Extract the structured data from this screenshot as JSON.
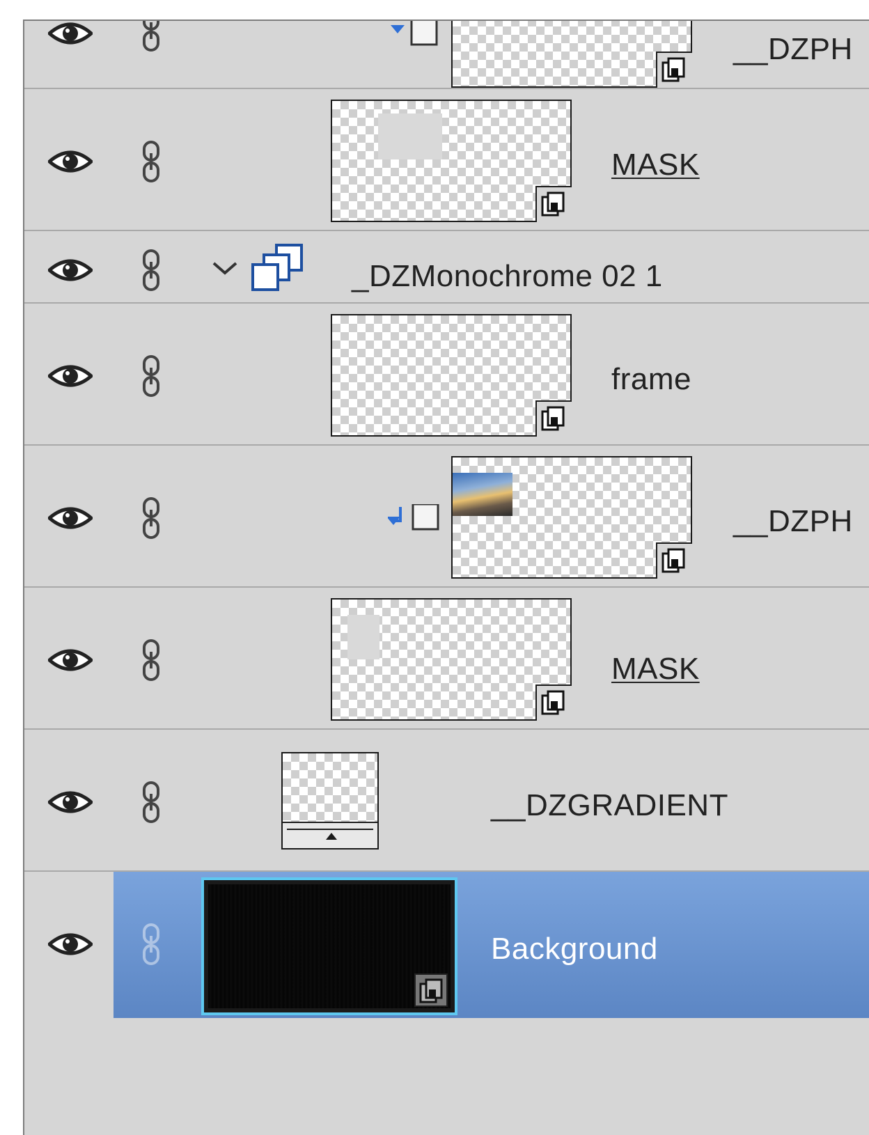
{
  "layers": [
    {
      "name": "__DZPH",
      "visible": true,
      "clipped": true,
      "kind": "smart-object"
    },
    {
      "name": "MASK",
      "visible": true,
      "kind": "smart-object",
      "underlined": true
    },
    {
      "name": "_DZMonochrome 02 1",
      "visible": true,
      "kind": "group",
      "expanded": true
    },
    {
      "name": "frame",
      "visible": true,
      "kind": "smart-object"
    },
    {
      "name": "__DZPH",
      "visible": true,
      "clipped": true,
      "kind": "smart-object"
    },
    {
      "name": "MASK",
      "visible": true,
      "kind": "smart-object",
      "underlined": true
    },
    {
      "name": "__DZGRADIENT",
      "visible": true,
      "kind": "gradient-fill"
    },
    {
      "name": "Background",
      "visible": true,
      "kind": "smart-object",
      "selected": true
    }
  ],
  "colors": {
    "panel": "#d6d6d6",
    "selection": "#5c86c4",
    "selected_thumb_border": "#5ec8f0",
    "clip_arrow": "#2e6fd6"
  },
  "icons": {
    "visibility": "eye-icon",
    "link": "chain-link-icon",
    "group": "layer-group-icon",
    "smart_object": "smart-object-badge-icon",
    "clipping": "clipping-mask-arrow-icon"
  }
}
